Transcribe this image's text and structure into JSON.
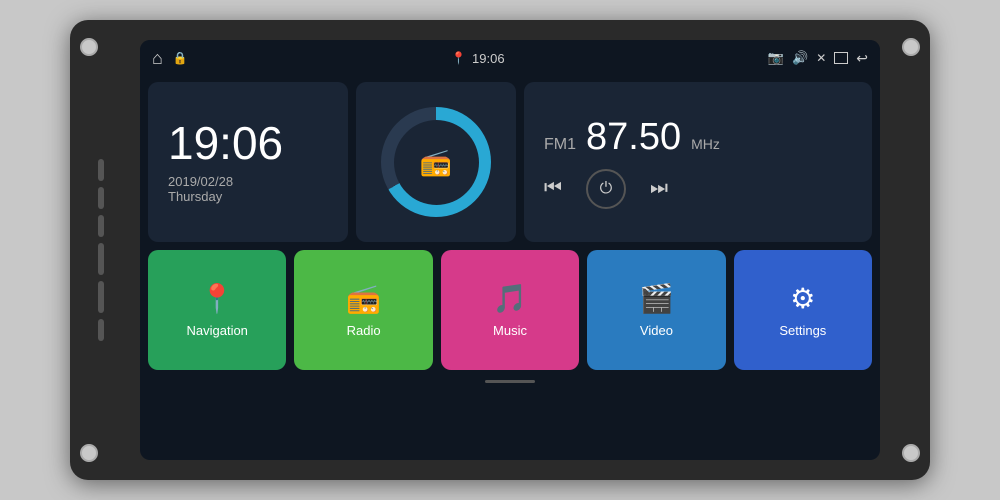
{
  "device": {
    "background_color": "#2a2a2a"
  },
  "status_bar": {
    "home_icon": "⌂",
    "lock_icon": "🔒",
    "location_icon": "📍",
    "time": "19:06",
    "camera_icon": "📷",
    "volume_icon": "🔊",
    "close_icon": "✕",
    "window_icon": "⬜",
    "back_icon": "↩"
  },
  "clock": {
    "time": "19:06",
    "date": "2019/02/28",
    "day": "Thursday"
  },
  "radio": {
    "band": "FM1",
    "frequency": "87.50",
    "unit": "MHz",
    "prev_icon": "⏮",
    "power_icon": "⏻",
    "next_icon": "⏭",
    "radio_icon": "📻"
  },
  "apps": [
    {
      "id": "navigation",
      "label": "Navigation",
      "icon": "📍",
      "color": "#27a05a"
    },
    {
      "id": "radio",
      "label": "Radio",
      "icon": "📻",
      "color": "#4cb846"
    },
    {
      "id": "music",
      "label": "Music",
      "icon": "🎵",
      "color": "#d63a8a"
    },
    {
      "id": "video",
      "label": "Video",
      "icon": "🎬",
      "color": "#2a7bbf"
    },
    {
      "id": "settings",
      "label": "Settings",
      "icon": "⚙",
      "color": "#3060cc"
    }
  ],
  "side_buttons": [
    "power",
    "home",
    "back",
    "vol_up",
    "vol_down",
    "antenna"
  ]
}
